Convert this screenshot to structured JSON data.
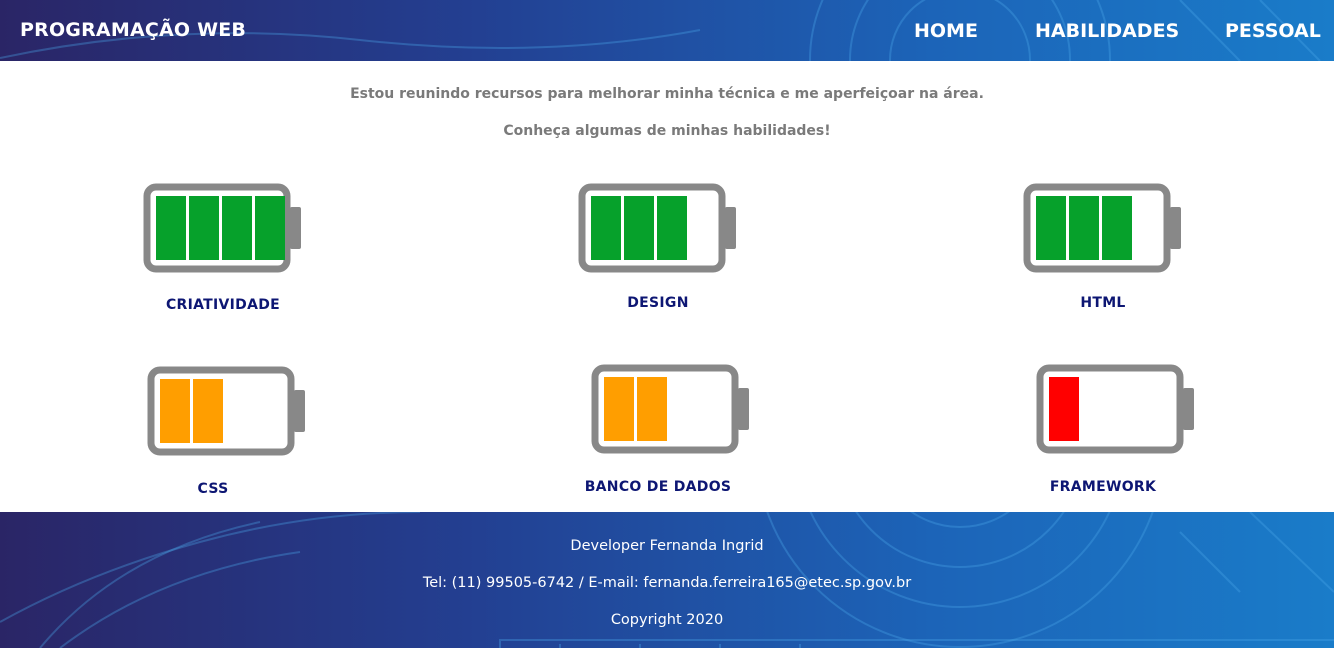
{
  "header": {
    "brand": "PROGRAMAÇÃO WEB",
    "nav": [
      "HOME",
      "HABILIDADES",
      "PESSOAL"
    ]
  },
  "intro": {
    "line1": "Estou reunindo recursos para melhorar minha técnica e me aperfeiçoar na área.",
    "line2": "Conheça algumas de minhas habilidades!"
  },
  "skills": [
    {
      "name": "CRIATIVIDADE",
      "level": 4,
      "max": 4,
      "color": "#06a12b"
    },
    {
      "name": "DESIGN",
      "level": 3,
      "max": 4,
      "color": "#06a12b"
    },
    {
      "name": "HTML",
      "level": 3,
      "max": 4,
      "color": "#06a12b"
    },
    {
      "name": "CSS",
      "level": 2,
      "max": 4,
      "color": "#ff9e00"
    },
    {
      "name": "BANCO DE DADOS",
      "level": 2,
      "max": 4,
      "color": "#ff9e00"
    },
    {
      "name": "FRAMEWORK",
      "level": 1,
      "max": 4,
      "color": "#ff0000"
    }
  ],
  "colors": {
    "battery_frame": "#888888",
    "brand_blue": "#233f91",
    "label_navy": "#0d1673",
    "intro_gray": "#7a7a7a"
  },
  "footer": {
    "developer": "Developer Fernanda Ingrid",
    "contact": "Tel: (11) 99505-6742 / E-mail: fernanda.ferreira165@etec.sp.gov.br",
    "copyright": "Copyright 2020"
  }
}
